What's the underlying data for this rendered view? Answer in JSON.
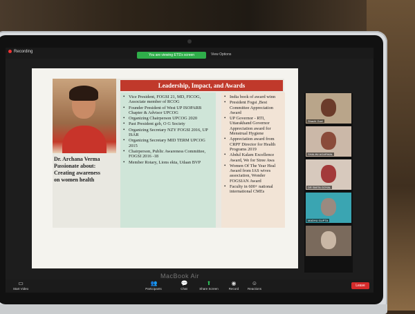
{
  "zoom": {
    "recording_label": "Recording",
    "share_notice": "You are viewing ETS's screen",
    "view_options": "View Options",
    "toolbar": {
      "video_label": "Start Video",
      "participants_label": "Participants",
      "participants_count": "155",
      "chat_label": "Chat",
      "share_label": "Share Screen",
      "record_label": "Record",
      "reactions_label": "Reactions",
      "leave_label": "Leave"
    }
  },
  "slide": {
    "heading": "Leadership, Impact, and Awards",
    "name_lines": [
      "Dr. Archana Verma",
      "Passionate about:",
      "Creating awareness",
      "on women health"
    ],
    "left_items": [
      "Vice President, FOGSI 21, MD, FICOG, Associate member of RCOG",
      "Founder President of West UP ISOPARB Chapter & Advisor UPCOG",
      "Organizing Chairperson UPCOG 2020",
      "Past President gzb, O G Society",
      "Organizing Secretary NZY FOGSI 2016, UP ISAR",
      "Organizing Secretary MID TERM UPCOG 2015",
      "Chairperson, Public Awareness Committee, FOGSI 2016 -18",
      "Member Rotary, Lions ekta, Udaan BVP"
    ],
    "right_items": [
      "India book of award winn",
      "President Fogsi ,Best|Committee Appreciation|Award",
      "UP Governor - RTI,|Uttarakhand Governor|Appreciation award for|Menstrual Hygiene",
      "Appreciation award from|CRPF Director for Health|Programs 2019",
      "Abdul Kalam Excellence|Award, We for Stree Awa",
      "Women Of The Year Heal|Award from IAS wives|association, Wonder|FOGSIAN Award",
      "Faculty in 600+ national|international CMEs"
    ]
  },
  "participants": [
    {
      "name": "Shachi Goel"
    },
    {
      "name": "SHALINI AGARWAL"
    },
    {
      "name": "DR SMITA GOYAL"
    },
    {
      "name": "MADHU GUPTA"
    },
    {
      "name": ""
    }
  ],
  "laptop_brand": "MacBook Air"
}
